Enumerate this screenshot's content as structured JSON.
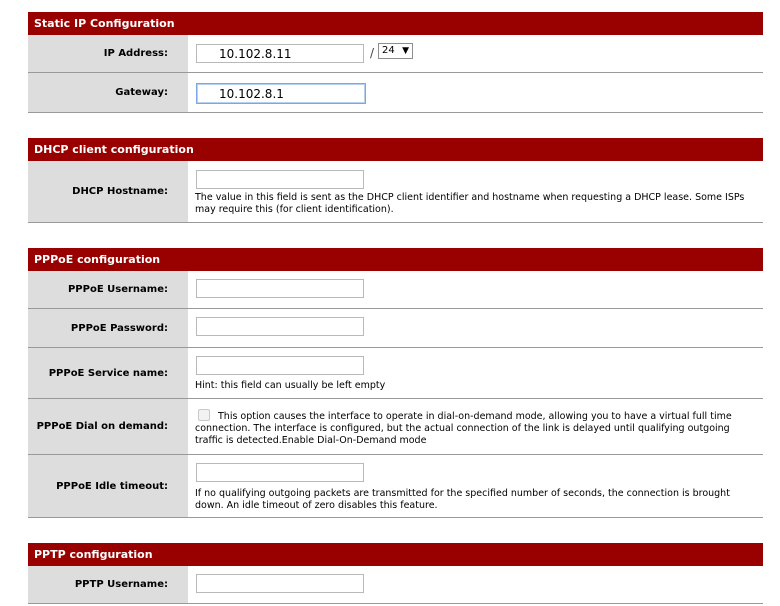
{
  "static_ip": {
    "header": "Static IP Configuration",
    "ip_label": "IP Address:",
    "ip_value": "10.102.8.11",
    "slash": "/",
    "subnet_value": "24",
    "gateway_label": "Gateway:",
    "gateway_value": "10.102.8.1"
  },
  "dhcp": {
    "header": "DHCP client configuration",
    "hostname_label": "DHCP Hostname:",
    "hostname_value": "",
    "hostname_desc": "The value in this field is sent as the DHCP client identifier and hostname when requesting a DHCP lease. Some ISPs may require this (for client identification)."
  },
  "pppoe": {
    "header": "PPPoE configuration",
    "username_label": "PPPoE Username:",
    "username_value": "",
    "password_label": "PPPoE Password:",
    "password_value": "",
    "service_label": "PPPoE Service name:",
    "service_value": "",
    "service_hint": "Hint: this field can usually be left empty",
    "dial_label": "PPPoE Dial on demand:",
    "dial_checked": false,
    "dial_desc": "This option causes the interface to operate in dial-on-demand mode, allowing you to have a virtual full time connection. The interface is configured, but the actual connection of the link is delayed until qualifying outgoing traffic is detected.Enable Dial-On-Demand mode",
    "idle_label": "PPPoE Idle timeout:",
    "idle_value": "",
    "idle_desc": "If no qualifying outgoing packets are transmitted for the specified number of seconds, the connection is brought down. An idle timeout of zero disables this feature."
  },
  "pptp": {
    "header": "PPTP configuration",
    "username_label": "PPTP Username:",
    "username_value": ""
  },
  "colors": {
    "header_bg": "#990000",
    "label_bg": "#dddddd",
    "row_border": "#999999"
  },
  "icons": {
    "field_icon": "pencil-icon"
  }
}
